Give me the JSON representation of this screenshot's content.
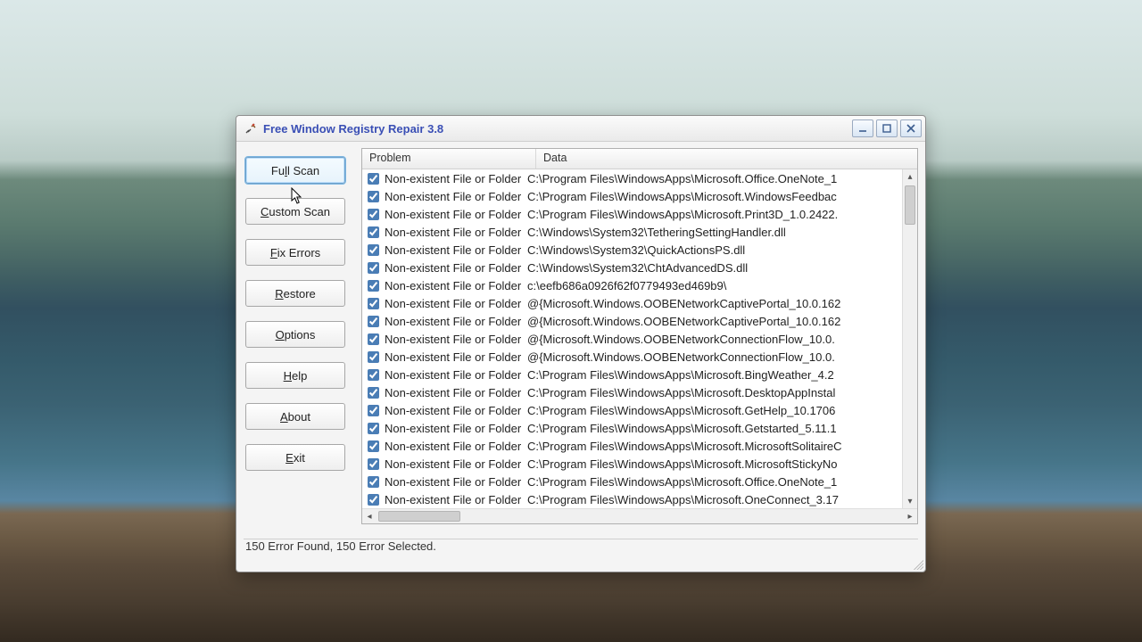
{
  "window": {
    "title": "Free Window Registry Repair 3.8"
  },
  "sidebar": {
    "full_scan_pre": "Fu",
    "full_scan_u": "l",
    "full_scan_post": "l Scan",
    "custom_scan_u": "C",
    "custom_scan_post": "ustom Scan",
    "fix_errors_u": "F",
    "fix_errors_post": "ix Errors",
    "restore_u": "R",
    "restore_post": "estore",
    "options_u": "O",
    "options_post": "ptions",
    "help_u": "H",
    "help_post": "elp",
    "about_u": "A",
    "about_post": "bout",
    "exit_u": "E",
    "exit_post": "xit"
  },
  "columns": {
    "problem": "Problem",
    "data": "Data"
  },
  "rows": [
    {
      "problem": "Non-existent File or Folder",
      "data": "C:\\Program Files\\WindowsApps\\Microsoft.Office.OneNote_1"
    },
    {
      "problem": "Non-existent File or Folder",
      "data": "C:\\Program Files\\WindowsApps\\Microsoft.WindowsFeedbac"
    },
    {
      "problem": "Non-existent File or Folder",
      "data": "C:\\Program Files\\WindowsApps\\Microsoft.Print3D_1.0.2422."
    },
    {
      "problem": "Non-existent File or Folder",
      "data": "C:\\Windows\\System32\\TetheringSettingHandler.dll"
    },
    {
      "problem": "Non-existent File or Folder",
      "data": "C:\\Windows\\System32\\QuickActionsPS.dll"
    },
    {
      "problem": "Non-existent File or Folder",
      "data": "C:\\Windows\\System32\\ChtAdvancedDS.dll"
    },
    {
      "problem": "Non-existent File or Folder",
      "data": "c:\\eefb686a0926f62f0779493ed469b9\\"
    },
    {
      "problem": "Non-existent File or Folder",
      "data": "@{Microsoft.Windows.OOBENetworkCaptivePortal_10.0.162"
    },
    {
      "problem": "Non-existent File or Folder",
      "data": "@{Microsoft.Windows.OOBENetworkCaptivePortal_10.0.162"
    },
    {
      "problem": "Non-existent File or Folder",
      "data": "@{Microsoft.Windows.OOBENetworkConnectionFlow_10.0."
    },
    {
      "problem": "Non-existent File or Folder",
      "data": "@{Microsoft.Windows.OOBENetworkConnectionFlow_10.0."
    },
    {
      "problem": "Non-existent File or Folder",
      "data": "C:\\Program Files\\WindowsApps\\Microsoft.BingWeather_4.2"
    },
    {
      "problem": "Non-existent File or Folder",
      "data": "C:\\Program Files\\WindowsApps\\Microsoft.DesktopAppInstal"
    },
    {
      "problem": "Non-existent File or Folder",
      "data": "C:\\Program Files\\WindowsApps\\Microsoft.GetHelp_10.1706"
    },
    {
      "problem": "Non-existent File or Folder",
      "data": "C:\\Program Files\\WindowsApps\\Microsoft.Getstarted_5.11.1"
    },
    {
      "problem": "Non-existent File or Folder",
      "data": "C:\\Program Files\\WindowsApps\\Microsoft.MicrosoftSolitaireC"
    },
    {
      "problem": "Non-existent File or Folder",
      "data": "C:\\Program Files\\WindowsApps\\Microsoft.MicrosoftStickyNo"
    },
    {
      "problem": "Non-existent File or Folder",
      "data": "C:\\Program Files\\WindowsApps\\Microsoft.Office.OneNote_1"
    },
    {
      "problem": "Non-existent File or Folder",
      "data": "C:\\Program Files\\WindowsApps\\Microsoft.OneConnect_3.17"
    }
  ],
  "status": {
    "text": "150 Error Found,  150 Error Selected."
  }
}
